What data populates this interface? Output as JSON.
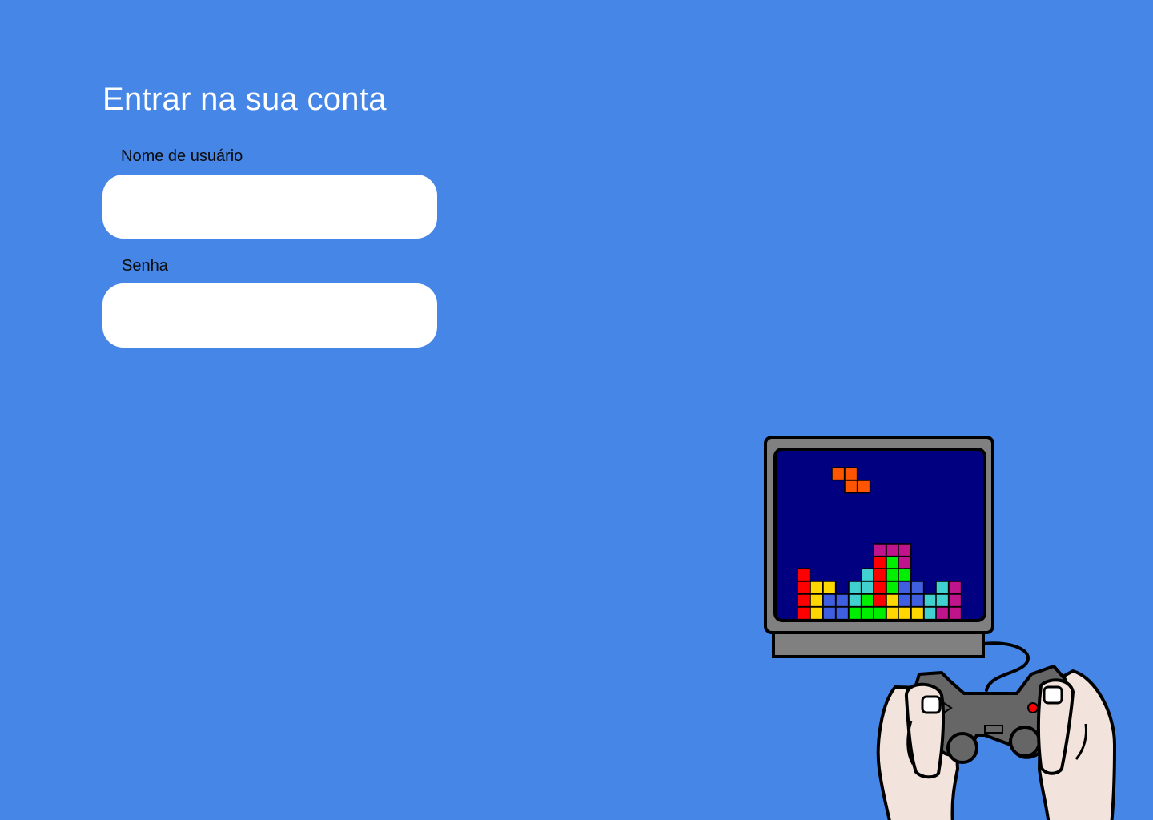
{
  "login": {
    "title": "Entrar na sua conta",
    "username_label": "Nome de usuário",
    "username_value": "",
    "password_label": "Senha",
    "password_value": ""
  },
  "illustration": {
    "icon": "tetris-tv-gamepad-illustration",
    "colors": {
      "background": "#4586E6",
      "screen": "#000080",
      "tv_body": "#808080",
      "skin": "#F2E4DC",
      "gamepad": "#666666"
    }
  }
}
